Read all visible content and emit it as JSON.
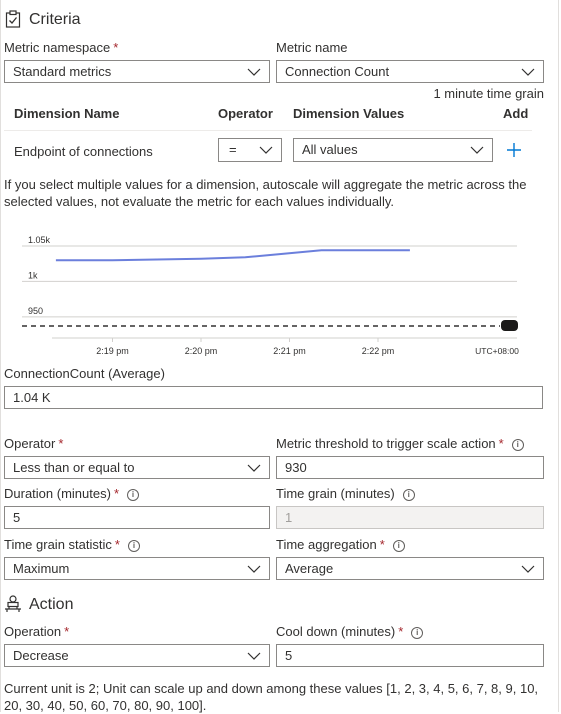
{
  "criteria": {
    "title": "Criteria",
    "metric_namespace": {
      "label": "Metric namespace",
      "value": "Standard metrics"
    },
    "metric_name": {
      "label": "Metric name",
      "value": "Connection Count"
    },
    "time_grain_note": "1 minute time grain",
    "dimension_table": {
      "headers": {
        "name": "Dimension Name",
        "operator": "Operator",
        "values": "Dimension Values",
        "add": "Add"
      },
      "rows": [
        {
          "name": "Endpoint of connections",
          "operator": "=",
          "values": "All values"
        }
      ]
    },
    "multi_value_note": "If you select multiple values for a dimension, autoscale will aggregate the metric across the selected values, not evaluate the metric for each values individually.",
    "current_metric": {
      "label": "ConnectionCount (Average)",
      "value": "1.04 K"
    },
    "operator": {
      "label": "Operator",
      "value": "Less than or equal to"
    },
    "threshold": {
      "label": "Metric threshold to trigger scale action",
      "value": "930"
    },
    "duration": {
      "label": "Duration (minutes)",
      "value": "5"
    },
    "time_grain": {
      "label": "Time grain (minutes)",
      "value": "1"
    },
    "time_grain_statistic": {
      "label": "Time grain statistic",
      "value": "Maximum"
    },
    "time_aggregation": {
      "label": "Time aggregation",
      "value": "Average"
    }
  },
  "chart_data": {
    "type": "line",
    "x": [
      "2:18 pm",
      "2:19 pm",
      "2:20 pm",
      "2:21 pm",
      "2:22 pm",
      "2:22.5 pm"
    ],
    "y_ticks": [
      "1.05k",
      "1k",
      "950"
    ],
    "x_ticks": [
      "2:19 pm",
      "2:20 pm",
      "2:21 pm",
      "2:22 pm"
    ],
    "timezone": "UTC+08:00",
    "series": [
      {
        "values": [
          1030,
          1030,
          1032,
          1034,
          1044,
          1044
        ]
      }
    ],
    "threshold_line": 930,
    "ylim": [
      920,
      1060
    ],
    "colors": {
      "series": "#6b7fdc",
      "threshold": "#323130",
      "grid": "#d2d0ce"
    }
  },
  "action": {
    "title": "Action",
    "operation": {
      "label": "Operation",
      "value": "Decrease"
    },
    "cool_down": {
      "label": "Cool down (minutes)",
      "value": "5"
    },
    "note": "Current unit is 2; Unit can scale up and down among these values [1, 2, 3, 4, 5, 6, 7, 8, 9, 10, 20, 30, 40, 50, 60, 70, 80, 90, 100]."
  },
  "colors": {
    "accent": "#0078d4",
    "required": "#a4262c",
    "border": "#8a8886"
  }
}
